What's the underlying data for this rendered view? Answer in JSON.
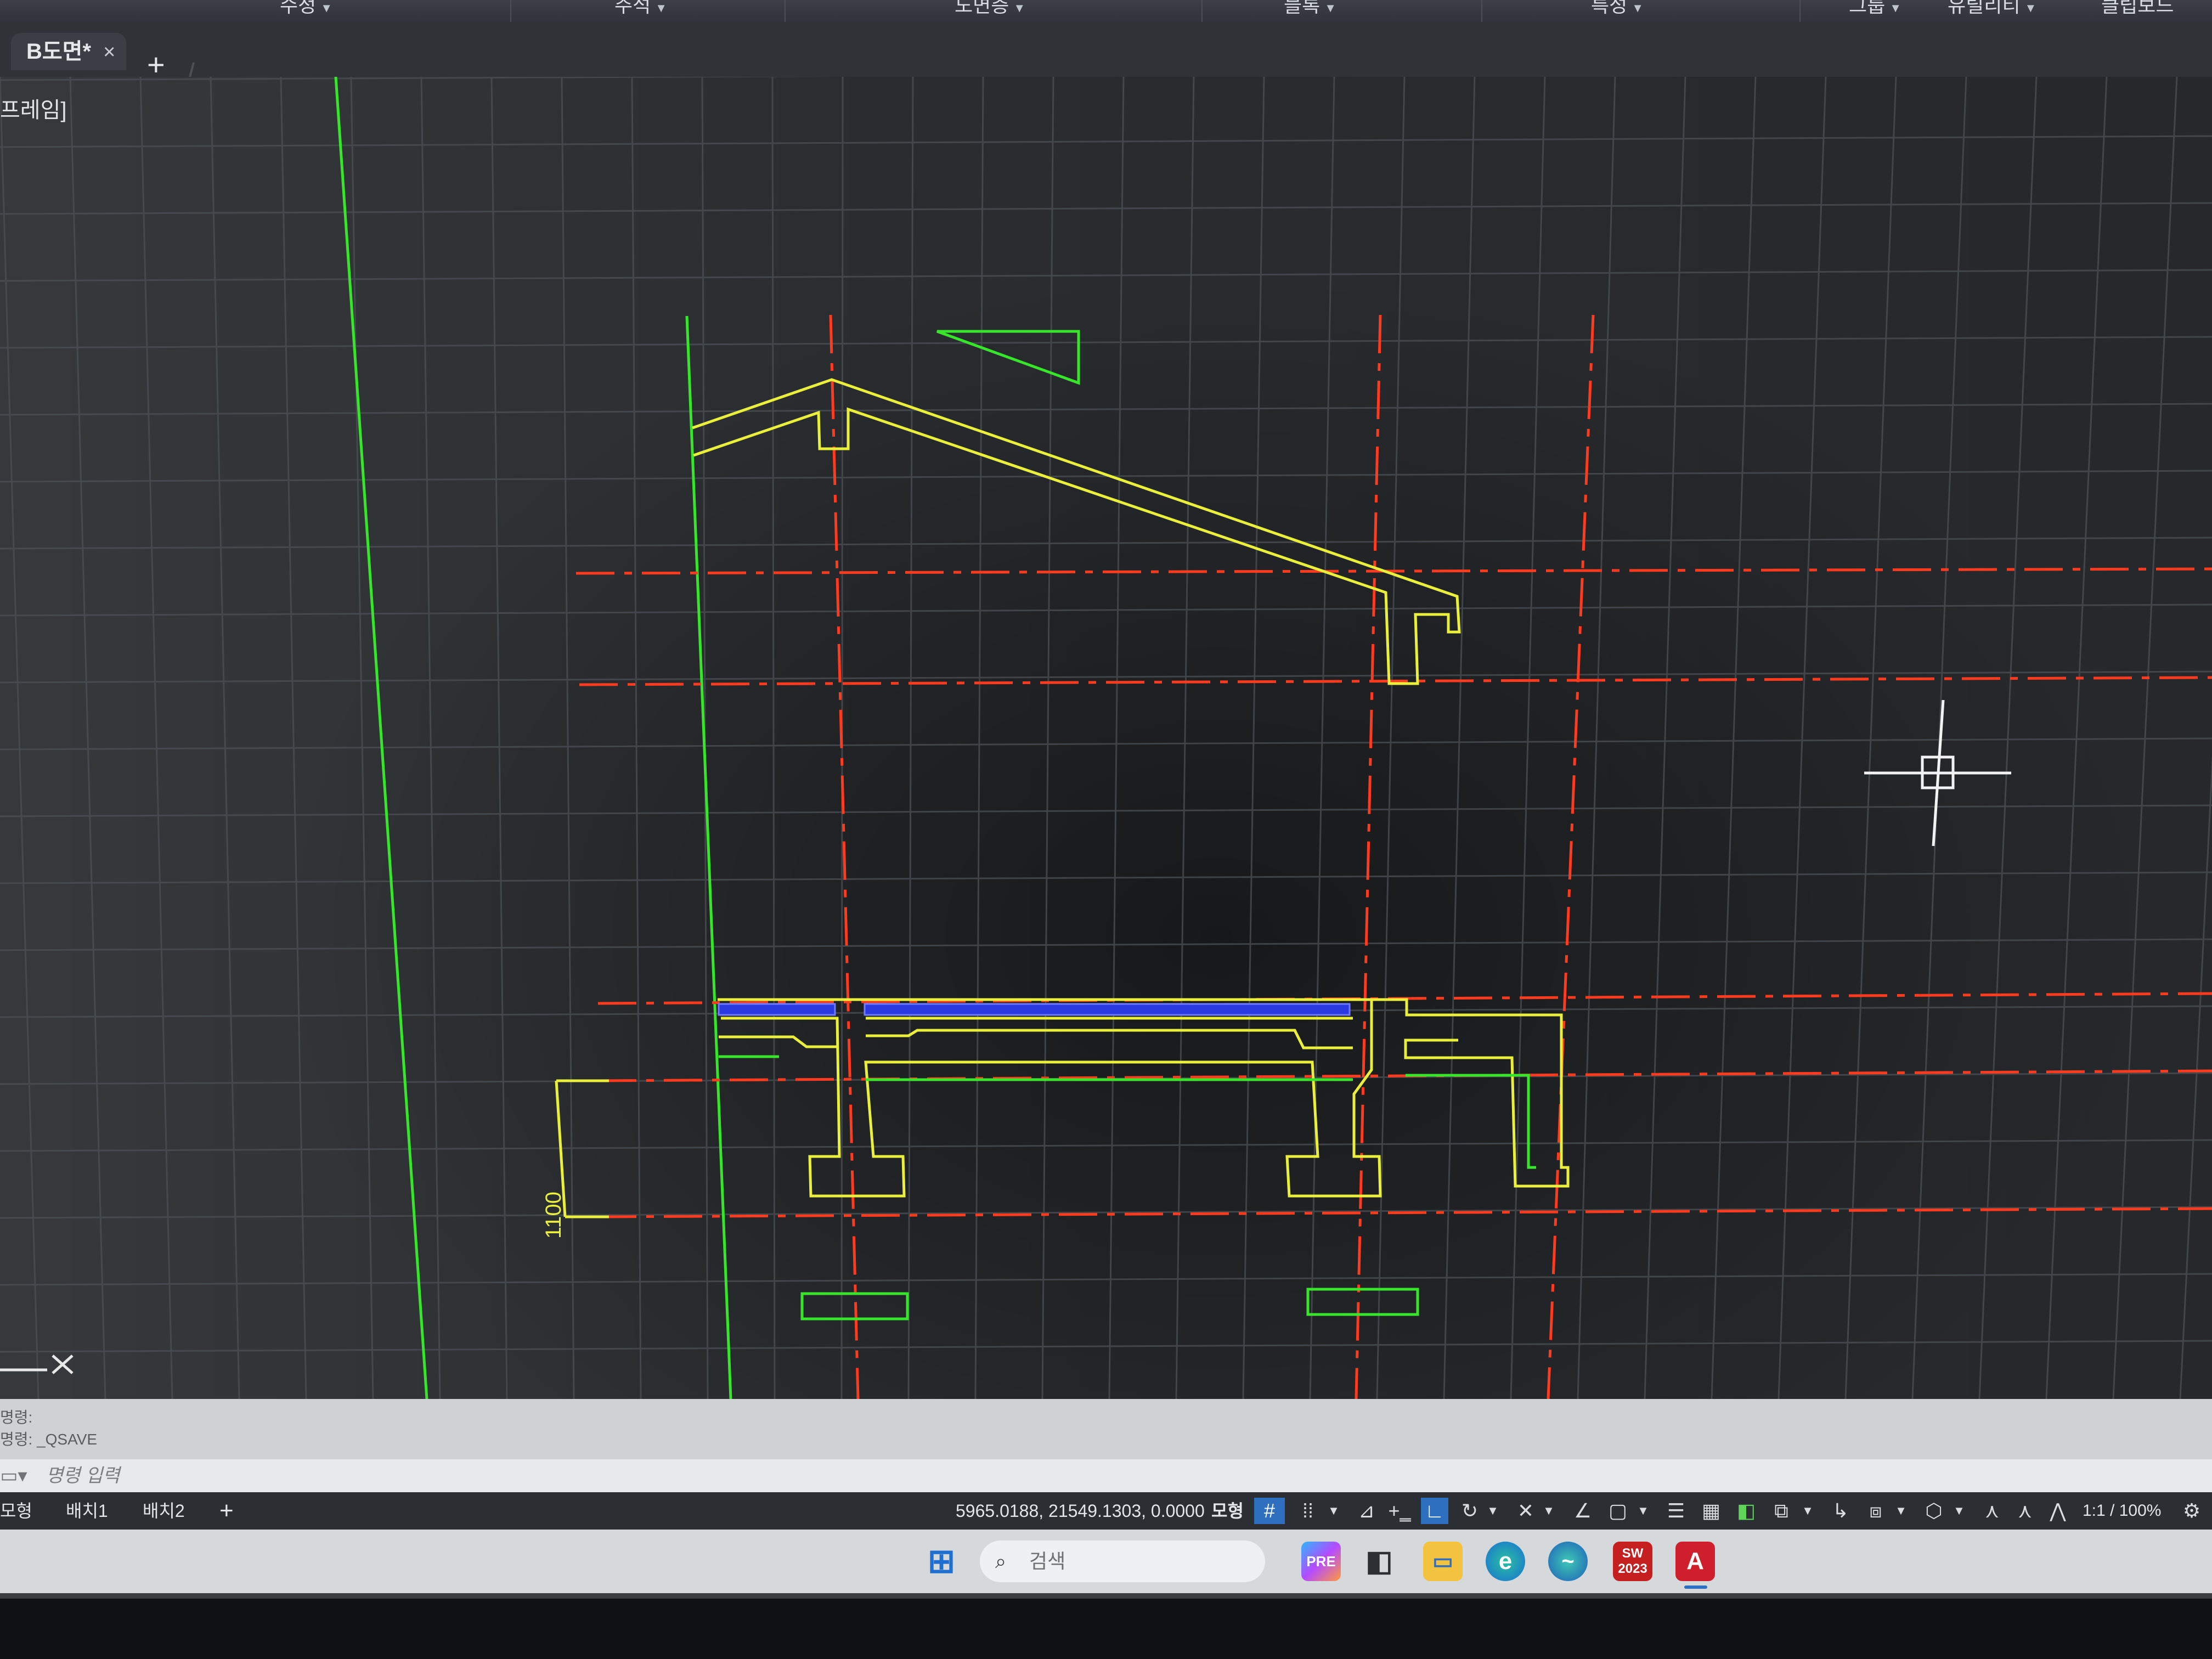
{
  "ribbon": {
    "items": [
      {
        "label": "수정"
      },
      {
        "label": "주석"
      },
      {
        "label": "도면층"
      },
      {
        "label": "블록"
      },
      {
        "label": "특성"
      },
      {
        "label": "그룹"
      },
      {
        "label": "유틸리티"
      },
      {
        "label": "클립보드"
      }
    ]
  },
  "tabs": {
    "active": "B도면*",
    "close_glyph": "×",
    "add_glyph": "+"
  },
  "viewport": {
    "label": "프레임]"
  },
  "drawing": {
    "dimension_text": "1100",
    "colors": {
      "grid": "#4a5056",
      "centerline": "#ff3b1f",
      "outline": "#e9ef3a",
      "ground": "#37e62a",
      "hatch": "#2a3ae0",
      "cursor": "#f2f2f2",
      "ucs": "#e8e8e8"
    }
  },
  "command": {
    "history": [
      "명령:",
      "명령:  _QSAVE"
    ],
    "placeholder": "명령 입력",
    "icon": "terminal-icon"
  },
  "status": {
    "layout_tabs": [
      "모형",
      "배치1",
      "배치2"
    ],
    "add_tab": "+",
    "coordinates": "5965.0188, 21549.1303, 0.0000",
    "model_label": "모형",
    "scale_label": "1:1 / 100%"
  },
  "taskbar": {
    "search_placeholder": "검색",
    "apps": [
      {
        "name": "start-icon"
      },
      {
        "name": "copilot-icon"
      },
      {
        "name": "task-view-icon"
      },
      {
        "name": "file-explorer-icon"
      },
      {
        "name": "edge-icon"
      },
      {
        "name": "app-icon"
      },
      {
        "name": "solidworks-icon",
        "label": "2023"
      },
      {
        "name": "autocad-icon",
        "label": "A"
      }
    ]
  }
}
